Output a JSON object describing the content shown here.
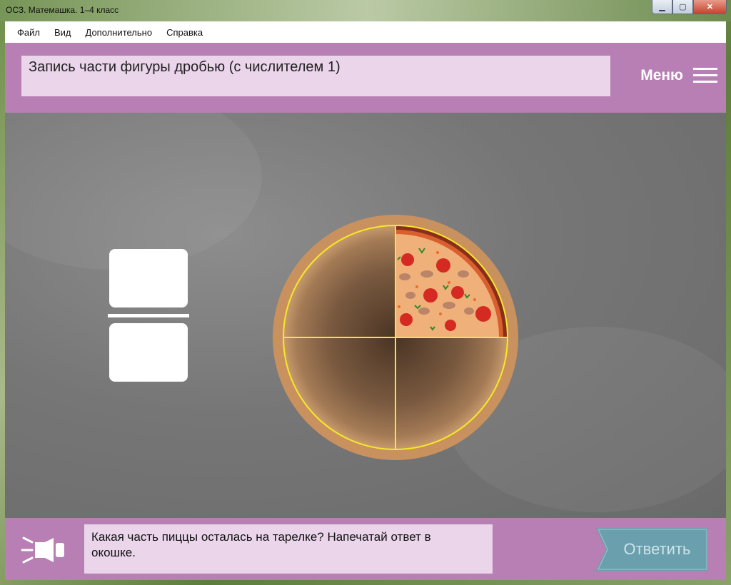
{
  "window": {
    "title": "ОСЗ. Матемашка. 1–4 класс"
  },
  "menubar": {
    "items": [
      "Файл",
      "Вид",
      "Дополнительно",
      "Справка"
    ]
  },
  "header": {
    "topic": "Запись части фигуры дробью (с числителем 1)",
    "menu_label": "Меню"
  },
  "task": {
    "fraction": {
      "numerator": "",
      "denominator": ""
    },
    "pizza": {
      "parts_total": 4,
      "parts_remaining": 1
    }
  },
  "footer": {
    "question": "Какая часть пиццы осталась на тарелке? Напечатай ответ в окошке.",
    "answer_label": "Ответить"
  },
  "colors": {
    "accent": "#b77fb4",
    "panel": "#ead5ea",
    "button": "#6a9fad",
    "divider": "#f4e829"
  }
}
